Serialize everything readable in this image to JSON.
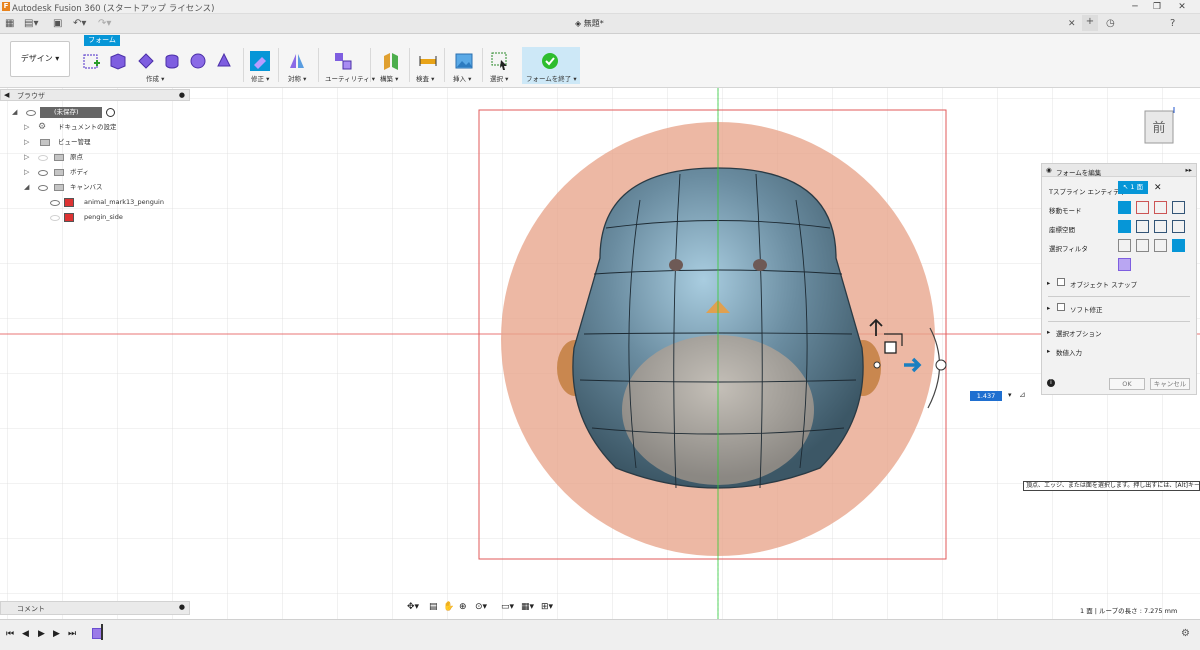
{
  "window": {
    "title": "Autodesk Fusion 360 (スタートアップ ライセンス)",
    "doc_tab": "無題*"
  },
  "ribbon": {
    "workspace": "デザイン",
    "form_tab": "フォーム",
    "groups": [
      {
        "label": "作成 ▾"
      },
      {
        "label": "修正 ▾"
      },
      {
        "label": "対称 ▾"
      },
      {
        "label": "ユーティリティ ▾"
      },
      {
        "label": "構築 ▾"
      },
      {
        "label": "検査 ▾"
      },
      {
        "label": "挿入 ▾"
      },
      {
        "label": "選択 ▾"
      },
      {
        "label": "フォームを終了 ▾"
      }
    ]
  },
  "browser": {
    "title": "ブラウザ",
    "root": "(未保存)",
    "items": [
      "ドキュメントの設定",
      "ビュー管理",
      "原点",
      "ボディ",
      "キャンバス"
    ],
    "canvas_children": [
      "animal_mark13_penguin",
      "pengin_side"
    ]
  },
  "comments": {
    "title": "コメント"
  },
  "status": {
    "text": "1 面 | ループの長さ : 7.275 mm"
  },
  "viewcube": {
    "face": "前"
  },
  "dimension": {
    "value": "1.437 mm"
  },
  "tooltip": {
    "text": "頂点、エッジ、または面を選択します。押し出すには、[Alt]キー"
  },
  "edit_form": {
    "title": "フォームを編集",
    "rows": [
      {
        "label": "Tスプライン エンティティ"
      },
      {
        "label": "移動モード"
      },
      {
        "label": "座標空間"
      },
      {
        "label": "選択フィルタ"
      }
    ],
    "entity_value": "1 面",
    "sections": [
      "オブジェクト スナップ",
      "ソフト修正",
      "選択オプション",
      "数値入力"
    ],
    "ok": "OK",
    "cancel": "キャンセル"
  },
  "colors": {
    "accent": "#0696d7",
    "canvas_ring": "#e8a48b",
    "body": "#6a8ca0",
    "grid": "#dcdcdc"
  }
}
